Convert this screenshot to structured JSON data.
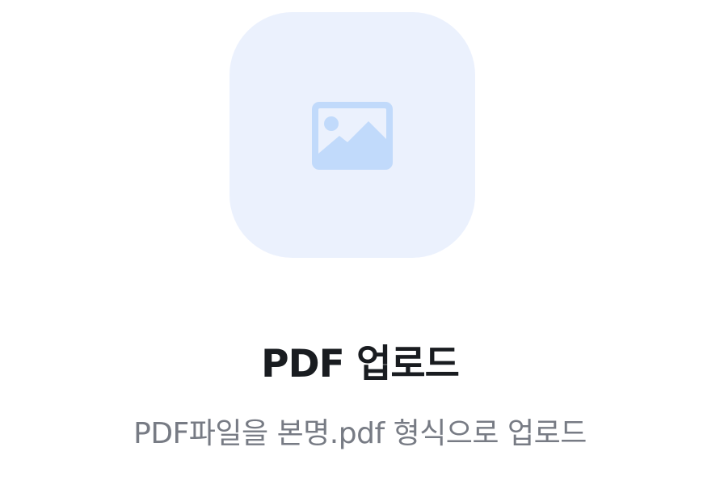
{
  "upload": {
    "icon": "image-placeholder-icon",
    "title": "PDF 업로드",
    "subtitle": "PDF파일을 본명.pdf 형식으로 업로드"
  },
  "colors": {
    "tile_background": "#ebf1fd",
    "icon": "#c1dafb",
    "title": "#191c20",
    "subtitle": "#777b84"
  }
}
